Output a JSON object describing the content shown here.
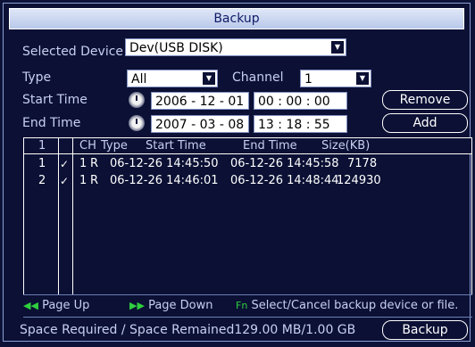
{
  "window": {
    "title": "Backup"
  },
  "form": {
    "selected_device": {
      "label": "Selected Device",
      "value": "Dev(USB DISK)"
    },
    "type": {
      "label": "Type",
      "value": "All"
    },
    "channel": {
      "label": "Channel",
      "value": "1"
    },
    "start_time": {
      "label": "Start Time",
      "date": "2006 - 12 - 01",
      "time": "00 : 00 : 00"
    },
    "end_time": {
      "label": "End Time",
      "date": "2007 - 03 - 08",
      "time": "13 : 18 : 55"
    }
  },
  "buttons": {
    "remove": "Remove",
    "add": "Add",
    "backup": "Backup"
  },
  "table": {
    "headers": {
      "index": "1",
      "ch": "CH",
      "type": "Type",
      "start": "Start Time",
      "end": "End Time",
      "size": "Size(KB)"
    },
    "rows": [
      {
        "index": "1",
        "checked": true,
        "ch": "1",
        "type": "R",
        "start": "06-12-26 14:45:50",
        "end": "06-12-26 14:45:58",
        "size": "7178"
      },
      {
        "index": "2",
        "checked": true,
        "ch": "1",
        "type": "R",
        "start": "06-12-26 14:46:01",
        "end": "06-12-26 14:48:44",
        "size": "124930"
      }
    ]
  },
  "footer": {
    "page_up": "Page Up",
    "page_down": "Page Down",
    "fn_hint": "Select/Cancel backup device or file.",
    "space": "Space Required / Space Remained129.00 MB/1.00 GB"
  },
  "icons": {
    "page_up": "page-up-arrow",
    "page_down": "page-down-arrow",
    "fn": "fn-key",
    "clock": "clock"
  },
  "colors": {
    "background": "#0b1034",
    "accent_green": "#2fcf3f",
    "title_bg": "#c9d6f0"
  }
}
